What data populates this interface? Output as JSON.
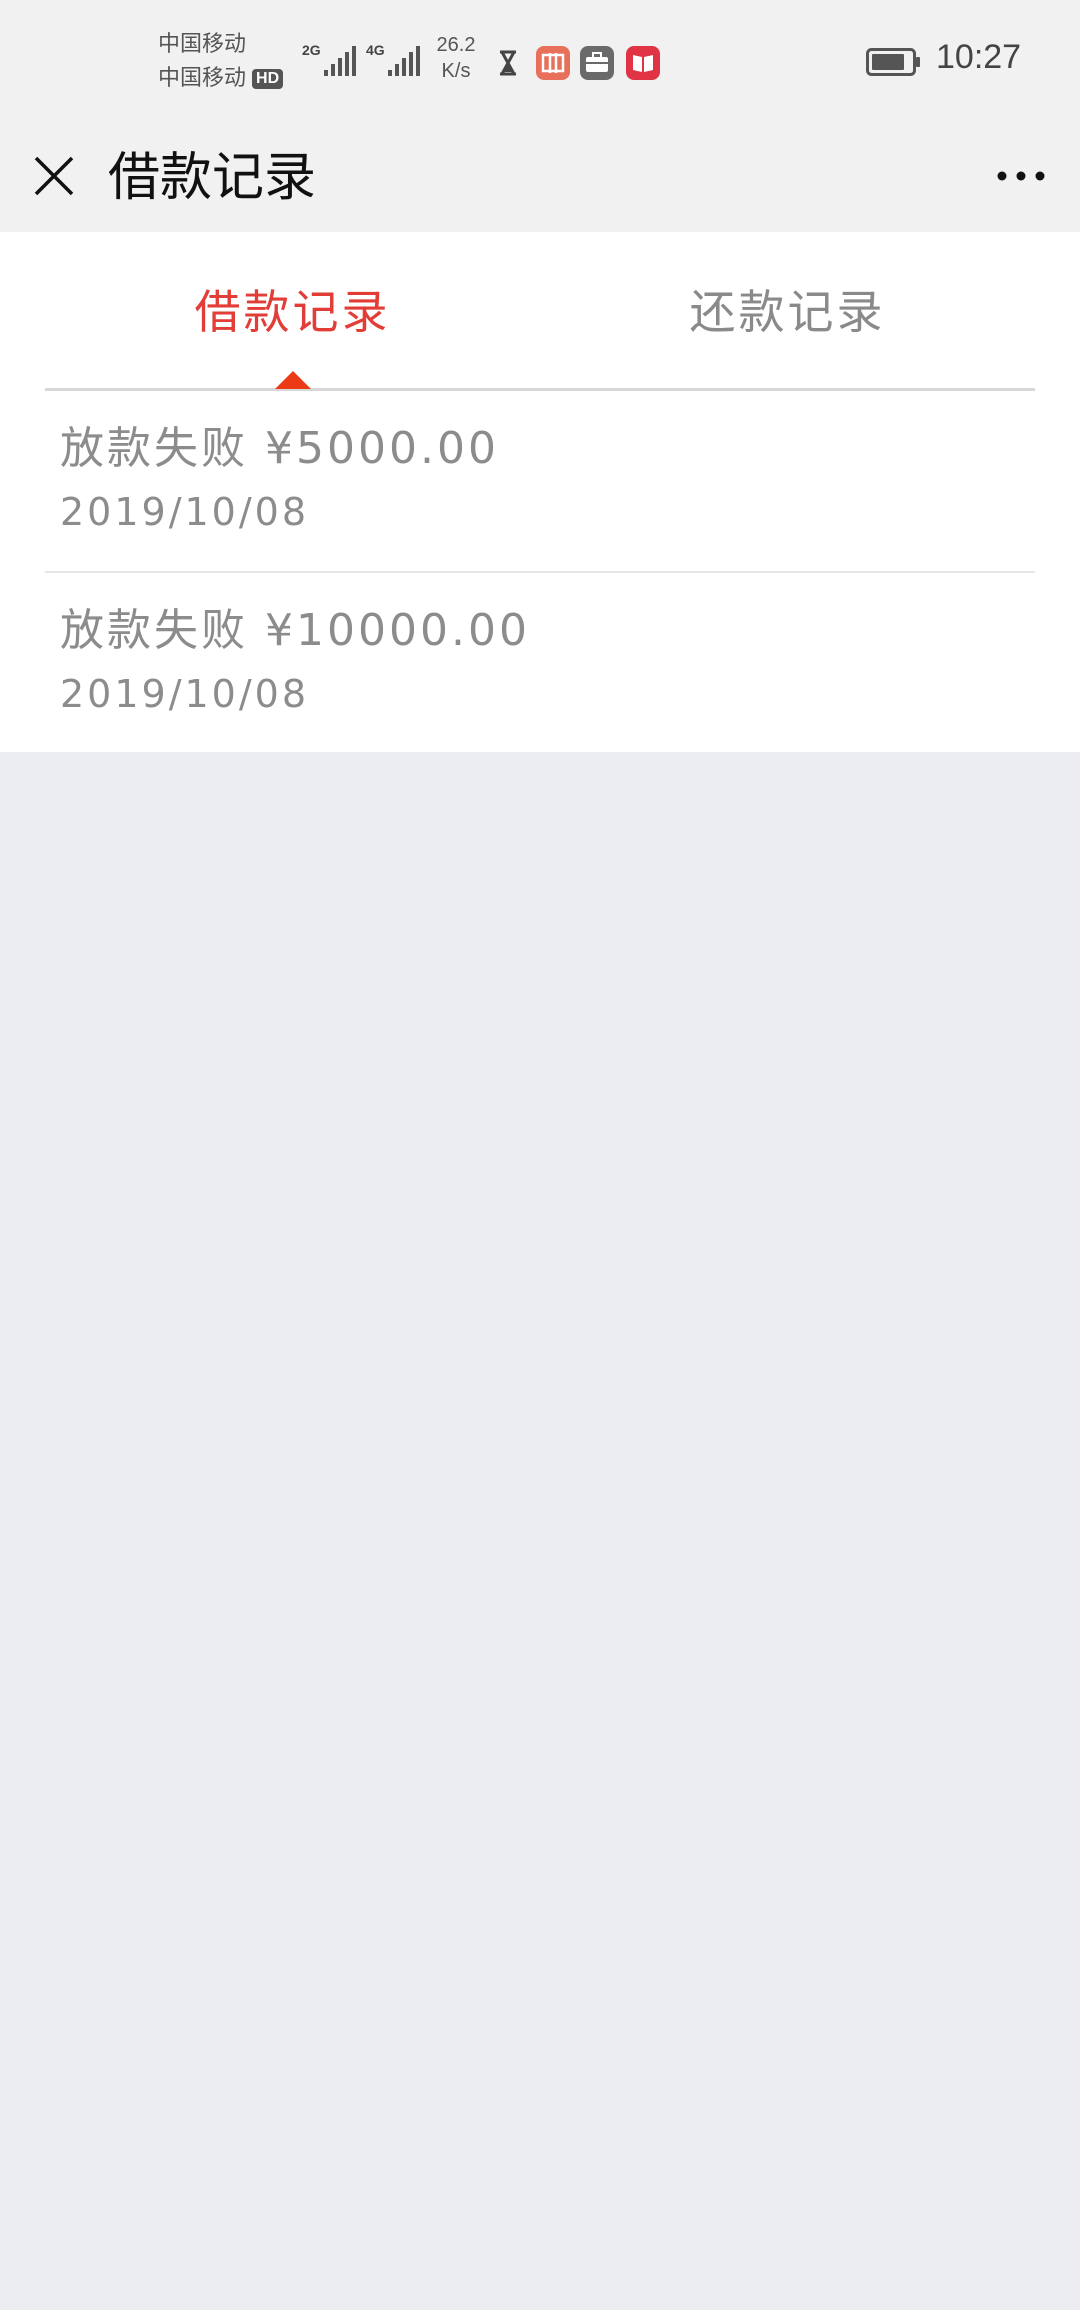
{
  "status_bar": {
    "carrier_1": "中国移动",
    "carrier_2": "中国移动",
    "hd_badge": "HD",
    "sim1_network": "2G",
    "sim2_network": "4G",
    "speed_value": "26.2",
    "speed_unit": "K/s",
    "time": "10:27",
    "icons": [
      "hourglass-icon",
      "ticket-app-icon",
      "briefcase-app-icon",
      "book-app-icon"
    ]
  },
  "header": {
    "title": "借款记录",
    "close_icon": "close-icon",
    "more_icon": "more-icon"
  },
  "tabs": [
    {
      "label": "借款记录",
      "active": true
    },
    {
      "label": "还款记录",
      "active": false
    }
  ],
  "records": [
    {
      "status": "放款失败",
      "amount": "¥5000.00",
      "date": "2019/10/08"
    },
    {
      "status": "放款失败",
      "amount": "¥10000.00",
      "date": "2019/10/08"
    }
  ],
  "colors": {
    "accent": "#e23d36",
    "indicator": "#ec3a17",
    "muted_text": "#8c8c8c",
    "page_background": "#ebedf0"
  }
}
